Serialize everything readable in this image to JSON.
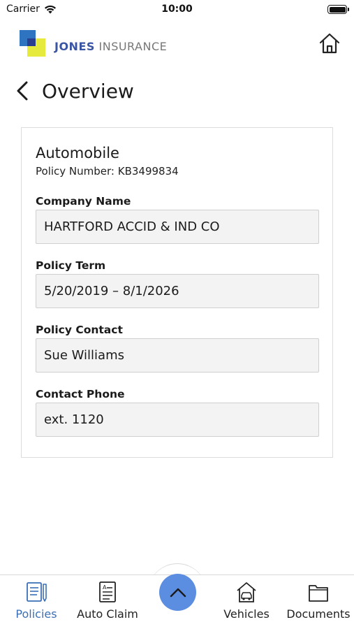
{
  "status_bar": {
    "carrier": "Carrier",
    "time": "10:00"
  },
  "header": {
    "brand_part1": "JONES",
    "brand_part2": "INSURANCE"
  },
  "page": {
    "title": "Overview"
  },
  "policy": {
    "type": "Automobile",
    "policy_number_line": "Policy Number: KB3499834",
    "fields": [
      {
        "label": "Company Name",
        "value": "HARTFORD ACCID & IND CO"
      },
      {
        "label": "Policy Term",
        "value": "5/20/2019 – 8/1/2026"
      },
      {
        "label": "Policy Contact",
        "value": "Sue Williams"
      },
      {
        "label": "Contact Phone",
        "value": "ext. 1120"
      }
    ]
  },
  "bottom_nav": {
    "items": [
      {
        "label": "Policies",
        "icon": "policies-icon",
        "active": true
      },
      {
        "label": "Auto Claim",
        "icon": "auto-claim-icon",
        "active": false
      },
      {
        "label": "Vehicles",
        "icon": "vehicles-icon",
        "active": false
      },
      {
        "label": "Documents",
        "icon": "documents-icon",
        "active": false
      }
    ],
    "fab_icon": "chevron-up-icon"
  },
  "colors": {
    "accent": "#3a6fb7",
    "fab": "#5b8de0",
    "logo_blue": "#2f74c0",
    "logo_yellow": "#e6ea3c",
    "field_bg": "#f3f3f3"
  }
}
